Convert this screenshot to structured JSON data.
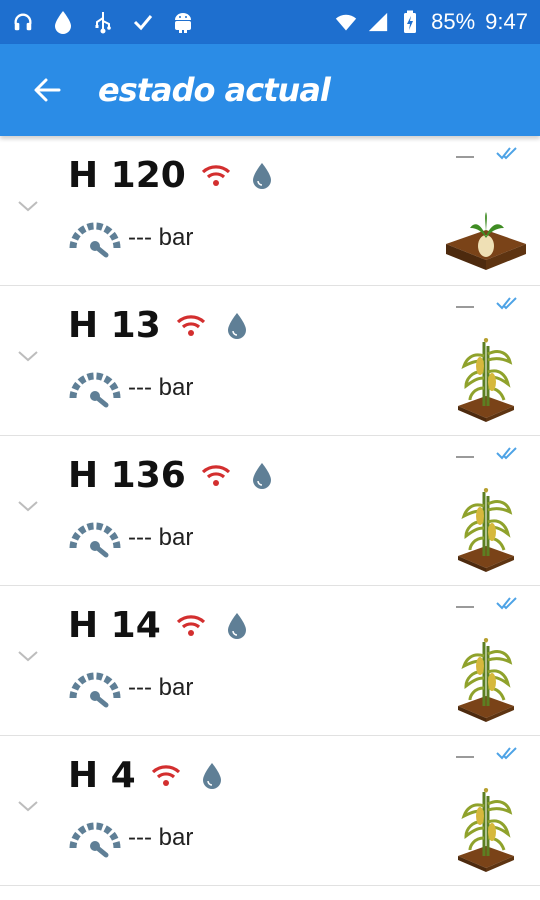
{
  "status_bar": {
    "battery": "85%",
    "time": "9:47",
    "icons": [
      "headphones-icon",
      "water-drop-icon",
      "usb-icon",
      "check-icon",
      "android-icon",
      "wifi-icon",
      "signal-icon",
      "battery-icon"
    ]
  },
  "app_bar": {
    "title": "estado actual",
    "back_icon": "arrow-left-icon"
  },
  "items": [
    {
      "name": "H 120",
      "pressure": "--- bar",
      "status": "—",
      "plant": "sprout"
    },
    {
      "name": "H 13",
      "pressure": "--- bar",
      "status": "—",
      "plant": "corn"
    },
    {
      "name": "H 136",
      "pressure": "--- bar",
      "status": "—",
      "plant": "corn"
    },
    {
      "name": "H 14",
      "pressure": "--- bar",
      "status": "—",
      "plant": "corn"
    },
    {
      "name": "H 4",
      "pressure": "--- bar",
      "status": "—",
      "plant": "corn"
    }
  ],
  "colors": {
    "status_bar": "#1e6fcf",
    "app_bar": "#2b8ce6",
    "wifi": "#d32f2f",
    "drop": "#5f7f96",
    "gauge": "#5f7f96",
    "check": "#4ea3e6"
  }
}
